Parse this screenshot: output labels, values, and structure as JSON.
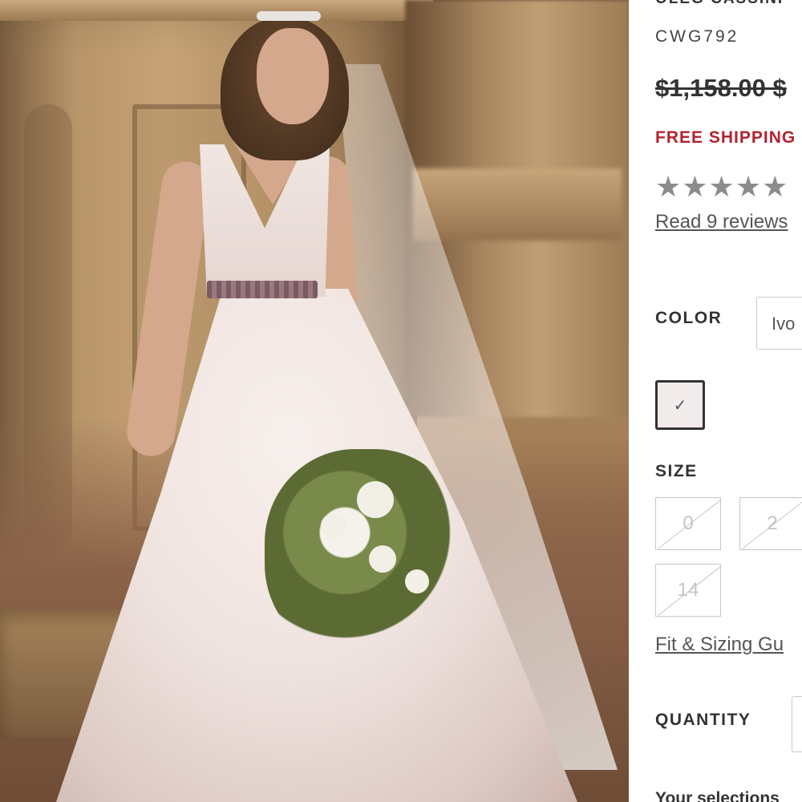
{
  "product": {
    "brand": "OLEG CASSINI",
    "sku": "CWG792",
    "price": "$1,158.00 $",
    "shipping": "FREE SHIPPING",
    "rating_stars": "★★★★★",
    "reviews_link": "Read 9 reviews"
  },
  "options": {
    "color_label": "COLOR",
    "color_value": "Ivo",
    "swatch_mark": "✓",
    "size_label": "SIZE",
    "sizes": [
      "0",
      "2",
      "14"
    ],
    "fit_link": "Fit & Sizing Gu",
    "quantity_label": "QUANTITY"
  },
  "footer": {
    "your_selections": "Your selections"
  }
}
